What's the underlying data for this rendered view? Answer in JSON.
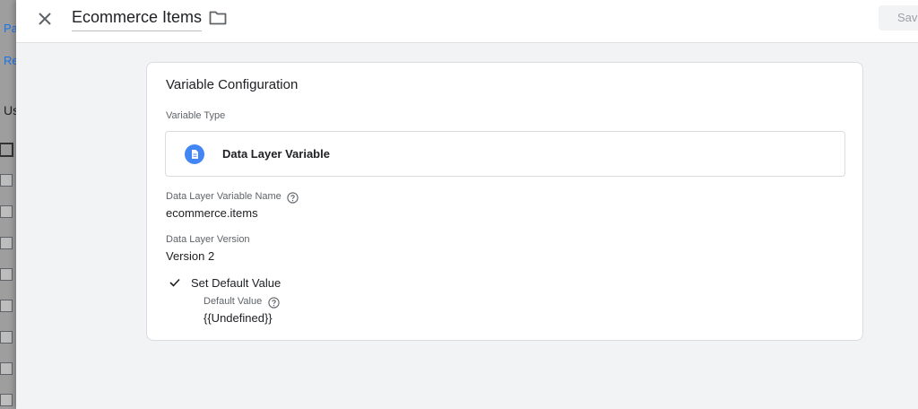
{
  "background": {
    "links": [
      "Pa",
      "Re"
    ],
    "text": "Us"
  },
  "header": {
    "title": "Ecommerce Items",
    "save_label": "Save",
    "close_icon": "close-icon",
    "folder_icon": "folder-icon"
  },
  "card": {
    "title": "Variable Configuration",
    "variable_type_label": "Variable Type",
    "variable_type_value": "Data Layer Variable",
    "variable_type_icon": "document-icon",
    "dlv_name_label": "Data Layer Variable Name",
    "dlv_name_value": "ecommerce.items",
    "version_label": "Data Layer Version",
    "version_value": "Version 2",
    "default_toggle_label": "Set Default Value",
    "default_value_label": "Default Value",
    "default_value_value": "{{Undefined}}"
  },
  "colors": {
    "accent": "#4285f4",
    "link": "#1a73e8"
  }
}
